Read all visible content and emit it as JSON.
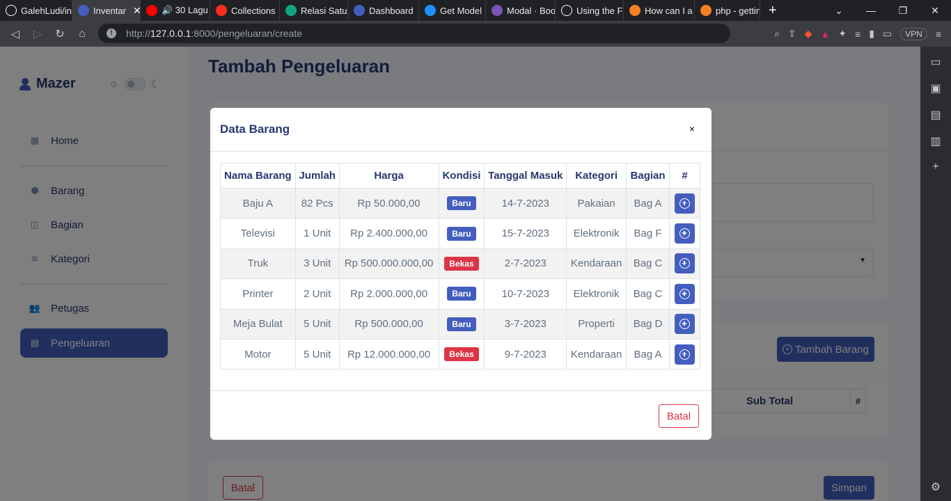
{
  "browser": {
    "tabs": [
      {
        "label": "GalehLudi/in",
        "icon": "github-icon",
        "color": "#ffffff"
      },
      {
        "label": "Inventar",
        "icon": "user-icon",
        "color": "#435ebe",
        "active": true
      },
      {
        "label": "🔊 30 Lagu",
        "icon": "youtube-icon",
        "color": "#ff0000"
      },
      {
        "label": "Collections",
        "icon": "laravel-icon",
        "color": "#ff2d20"
      },
      {
        "label": "Relasi Satu-",
        "icon": "chatgpt-icon",
        "color": "#10a37f"
      },
      {
        "label": "Dashboard",
        "icon": "user-icon",
        "color": "#435ebe"
      },
      {
        "label": "Get Model",
        "icon": "braces-icon",
        "color": "#1e90ff"
      },
      {
        "label": "Modal · Boo",
        "icon": "bootstrap-icon",
        "color": "#7952b3"
      },
      {
        "label": "Using the Fe",
        "icon": "medium-icon",
        "color": "#ffffff"
      },
      {
        "label": "How can I a",
        "icon": "stackoverflow-icon",
        "color": "#f48024"
      },
      {
        "label": "php - gettin",
        "icon": "stackoverflow-icon",
        "color": "#f48024"
      }
    ],
    "url_prefix": "http://",
    "url_host": "127.0.0.1",
    "url_path": ":8000/pengeluaran/create",
    "vpn_label": "VPN"
  },
  "sidebar": {
    "brand": "Mazer",
    "items": [
      {
        "label": "Home",
        "icon": "grid-icon"
      },
      {
        "label": "Barang",
        "icon": "box-icon"
      },
      {
        "label": "Bagian",
        "icon": "layers-icon"
      },
      {
        "label": "Kategori",
        "icon": "stack-icon"
      },
      {
        "label": "Petugas",
        "icon": "people-icon"
      },
      {
        "label": "Pengeluaran",
        "icon": "file-icon",
        "active": true
      }
    ]
  },
  "main": {
    "title": "Tambah Pengeluaran",
    "add_item_label": "Tambah Barang",
    "subtotal_header": "Sub Total",
    "hash_header": "#",
    "cancel_label": "Batal",
    "save_label": "Simpan"
  },
  "modal": {
    "title": "Data Barang",
    "close_label": "×",
    "columns": [
      "Nama Barang",
      "Jumlah",
      "Harga",
      "Kondisi",
      "Tanggal Masuk",
      "Kategori",
      "Bagian",
      "#"
    ],
    "rows": [
      {
        "nama": "Baju A",
        "jumlah": "82 Pcs",
        "harga": "Rp 50.000,00",
        "kondisi": "Baru",
        "tanggal": "14-7-2023",
        "kategori": "Pakaian",
        "bagian": "Bag A"
      },
      {
        "nama": "Televisi",
        "jumlah": "1 Unit",
        "harga": "Rp 2.400.000,00",
        "kondisi": "Baru",
        "tanggal": "15-7-2023",
        "kategori": "Elektronik",
        "bagian": "Bag F"
      },
      {
        "nama": "Truk",
        "jumlah": "3 Unit",
        "harga": "Rp 500.000.000,00",
        "kondisi": "Bekas",
        "tanggal": "2-7-2023",
        "kategori": "Kendaraan",
        "bagian": "Bag C"
      },
      {
        "nama": "Printer",
        "jumlah": "2 Unit",
        "harga": "Rp 2.000.000,00",
        "kondisi": "Baru",
        "tanggal": "10-7-2023",
        "kategori": "Elektronik",
        "bagian": "Bag C"
      },
      {
        "nama": "Meja Bulat",
        "jumlah": "5 Unit",
        "harga": "Rp 500.000,00",
        "kondisi": "Baru",
        "tanggal": "3-7-2023",
        "kategori": "Properti",
        "bagian": "Bag D"
      },
      {
        "nama": "Motor",
        "jumlah": "5 Unit",
        "harga": "Rp 12.000.000,00",
        "kondisi": "Bekas",
        "tanggal": "9-7-2023",
        "kategori": "Kendaraan",
        "bagian": "Bag A"
      }
    ],
    "badge_colors": {
      "Baru": "#435ebe",
      "Bekas": "#dc3545"
    },
    "cancel_label": "Batal"
  }
}
